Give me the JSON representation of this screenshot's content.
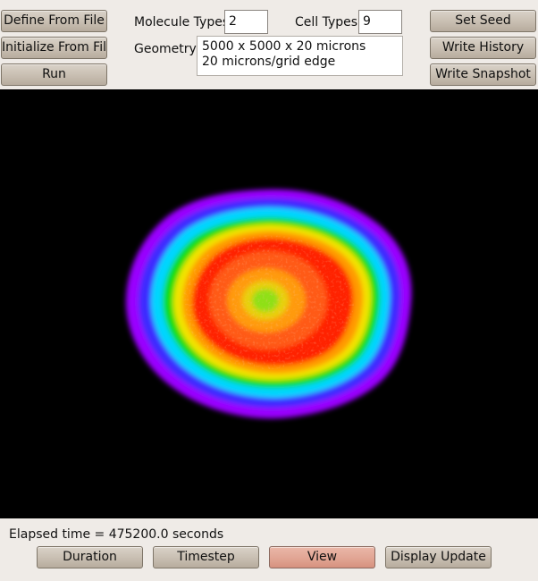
{
  "toolbar": {
    "define_from_file": "Define From File",
    "initialize_from_file": "Initialize From File",
    "run": "Run",
    "set_seed": "Set Seed",
    "write_history": "Write History",
    "write_snapshot": "Write Snapshot"
  },
  "params": {
    "molecule_types_label": "Molecule Types",
    "molecule_types_value": "2",
    "cell_types_label": "Cell Types",
    "cell_types_value": "9",
    "geometry_label": "Geometry",
    "geometry_lines": [
      "5000 x 5000 x 20 microns",
      "20 microns/grid edge"
    ]
  },
  "status": {
    "elapsed": "Elapsed time = 475200.0 seconds"
  },
  "bottom_buttons": {
    "duration": "Duration",
    "timestep": "Timestep",
    "view": "View",
    "display_update": "Display Update"
  },
  "colors": {
    "window_bg": "#efebe7",
    "canvas_bg": "#000000",
    "active_button": "#e1a594"
  },
  "visualization": {
    "description_colors": [
      "#9400ff",
      "#3a35ff",
      "#00d6ff",
      "#00e000",
      "#c8f000",
      "#ffd000",
      "#ff8a00",
      "#ff2a00",
      "#ff5a10",
      "#9fe010"
    ]
  }
}
